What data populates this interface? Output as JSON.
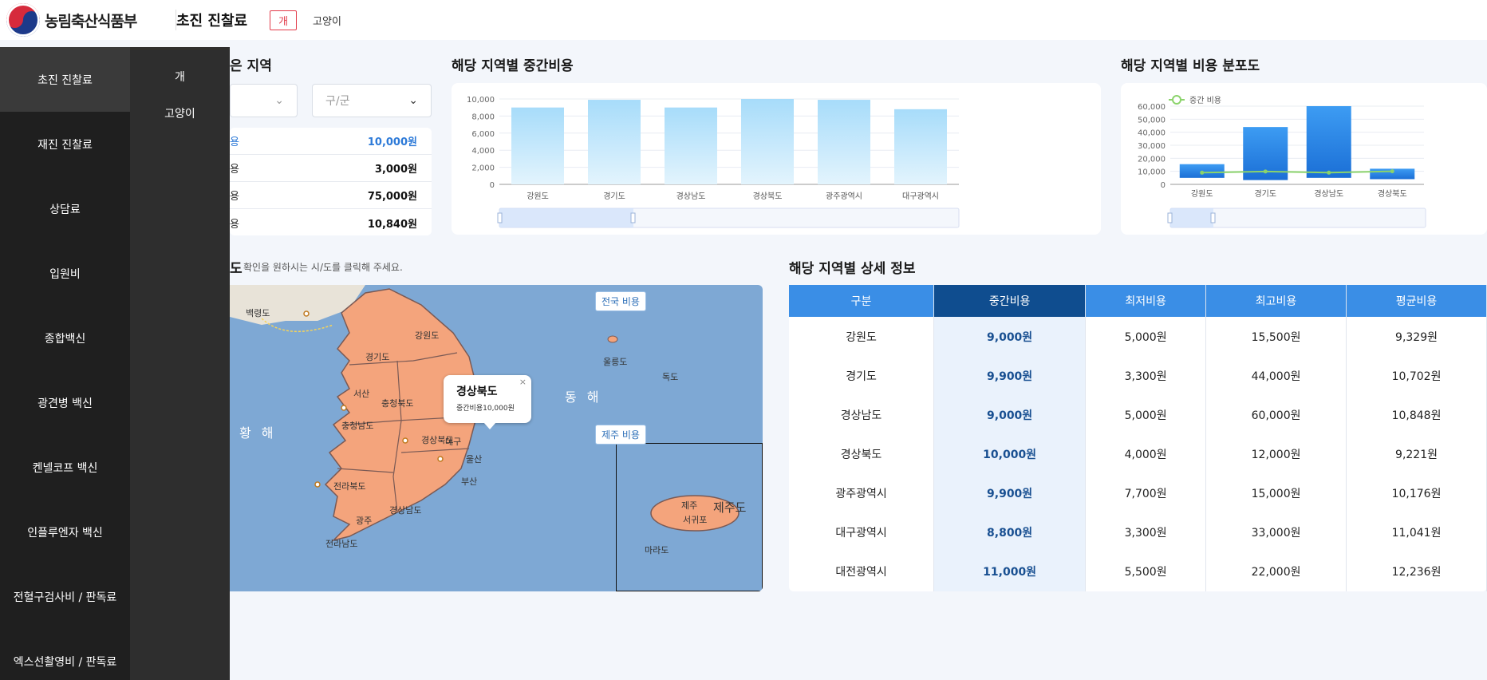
{
  "header": {
    "org_name": "농림축산식품부",
    "page_title": "초진 진찰료",
    "animal_tabs": [
      "개",
      "고양이"
    ]
  },
  "sidebar": {
    "items": [
      "초진 진찰료",
      "재진 진찰료",
      "상담료",
      "입원비",
      "종합백신",
      "광견병 백신",
      "켄넬코프 백신",
      "인플루엔자 백신",
      "전혈구검사비 / 판독료",
      "엑스선촬영비 / 판독료"
    ],
    "sub_items": [
      "개",
      "고양이"
    ]
  },
  "region_section": {
    "title_partial": "은 지역",
    "district_placeholder": "구/군",
    "costs": [
      {
        "label": "용",
        "value": "10,000원"
      },
      {
        "label": "용",
        "value": "3,000원"
      },
      {
        "label": "용",
        "value": "75,000원"
      },
      {
        "label": "용",
        "value": "10,840원"
      }
    ]
  },
  "median_chart_title": "해당 지역별 중간비용",
  "distribution_chart_title": "해당 지역별 비용 분포도",
  "map_section": {
    "title_partial": "도",
    "hint": "확인을 원하시는 시/도를 클릭해 주세요.",
    "national_button": "전국 비용",
    "jeju_button": "제주 비용",
    "popup_title": "경상북도",
    "popup_subtitle": "중간비용10,000원",
    "popup_close": "×",
    "sea_west": "황 해",
    "sea_east": "동 해",
    "place_labels": [
      "울릉도",
      "독도",
      "백령도",
      "마라도",
      "제주",
      "서귀포",
      "제주도",
      "경상북도",
      "경상남도",
      "전라북도",
      "전라남도",
      "충청남도",
      "충청북도",
      "경기도",
      "강원도",
      "대구",
      "울산",
      "부산",
      "광주",
      "서산"
    ]
  },
  "detail_section": {
    "title": "해당 지역별 상세 정보",
    "columns": [
      "구분",
      "중간비용",
      "최저비용",
      "최고비용",
      "평균비용"
    ],
    "rows": [
      [
        "강원도",
        "9,000원",
        "5,000원",
        "15,500원",
        "9,329원"
      ],
      [
        "경기도",
        "9,900원",
        "3,300원",
        "44,000원",
        "10,702원"
      ],
      [
        "경상남도",
        "9,000원",
        "5,000원",
        "60,000원",
        "10,848원"
      ],
      [
        "경상북도",
        "10,000원",
        "4,000원",
        "12,000원",
        "9,221원"
      ],
      [
        "광주광역시",
        "9,900원",
        "7,700원",
        "15,000원",
        "10,176원"
      ],
      [
        "대구광역시",
        "8,800원",
        "3,300원",
        "33,000원",
        "11,041원"
      ],
      [
        "대전광역시",
        "11,000원",
        "5,500원",
        "22,000원",
        "12,236원"
      ]
    ]
  },
  "colors": {
    "accent": "#3a8ee6",
    "accent_dark": "#0f4d8f",
    "danger": "#e23b4a",
    "map_land": "#f4a47c"
  },
  "chart_data": [
    {
      "type": "bar",
      "title": "",
      "categories": [
        "강원도",
        "경기도",
        "경상남도",
        "경상북도",
        "광주광역시",
        "대구광역시"
      ],
      "values": [
        9000,
        9900,
        9000,
        10000,
        9900,
        8800
      ],
      "ylim": [
        0,
        10000
      ],
      "yticks": [
        "0",
        "2,000",
        "4,000",
        "6,000",
        "8,000",
        "10,000"
      ]
    },
    {
      "type": "bar",
      "title": "",
      "categories": [
        "강원도",
        "경기도",
        "경상남도",
        "경상북도"
      ],
      "series": [
        {
          "name": "",
          "low": [
            5000,
            3300,
            5000,
            4000
          ],
          "high": [
            15500,
            44000,
            60000,
            12000
          ]
        },
        {
          "name": "중간 비용",
          "values": [
            9000,
            9900,
            9000,
            10000
          ]
        }
      ],
      "ylim": [
        0,
        60000
      ],
      "yticks": [
        "0",
        "10,000",
        "20,000",
        "30,000",
        "40,000",
        "50,000",
        "60,000"
      ],
      "legend": "top-left"
    }
  ]
}
